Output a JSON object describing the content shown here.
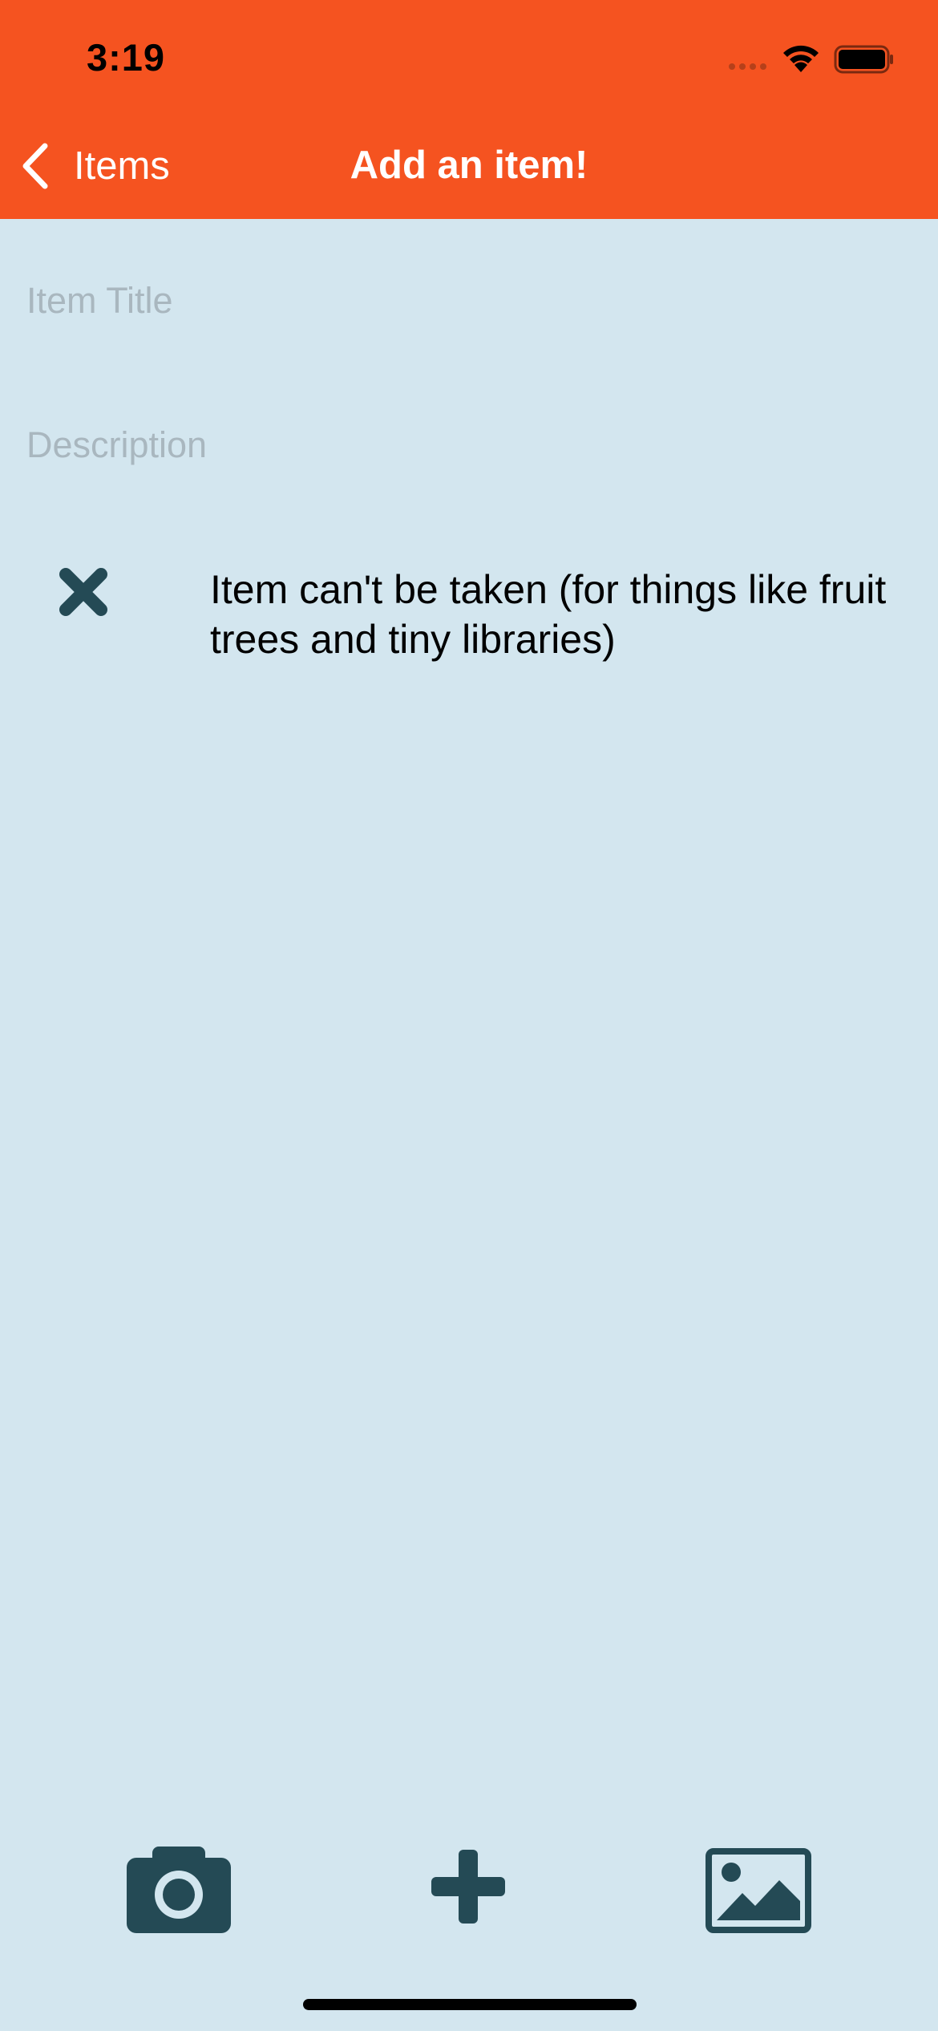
{
  "status_bar": {
    "time": "3:19"
  },
  "nav": {
    "back_label": "Items",
    "title": "Add an item!"
  },
  "form": {
    "title_placeholder": "Item Title",
    "title_value": "",
    "description_placeholder": "Description",
    "description_value": "",
    "cant_be_taken_label": "Item can't be taken (for things like fruit trees and tiny libraries)",
    "cant_be_taken_state": "unchecked"
  },
  "toolbar": {
    "camera_icon": "camera-icon",
    "add_icon": "plus-icon",
    "gallery_icon": "image-icon"
  },
  "colors": {
    "header": "#f55320",
    "background": "#d3e6ef",
    "icon": "#244a55"
  }
}
